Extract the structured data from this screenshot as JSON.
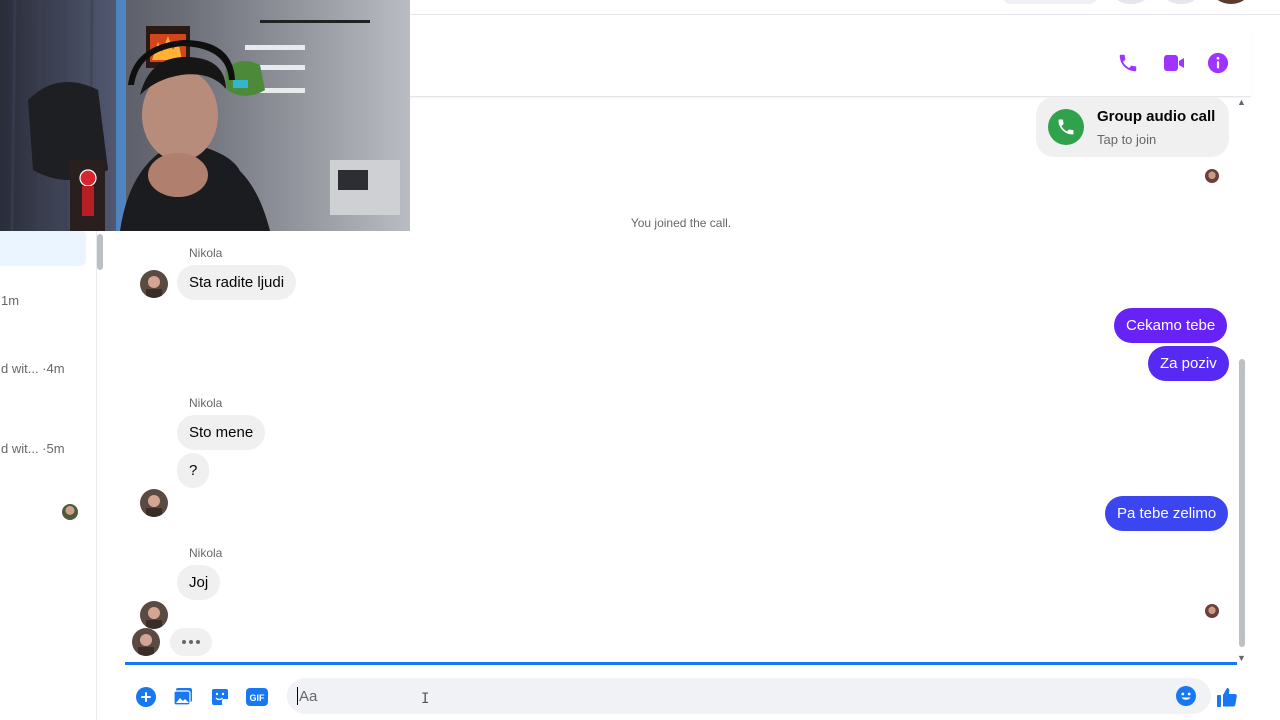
{
  "colors": {
    "accent_purple": "#a033ff",
    "bubble_violet": "#6723f5",
    "bubble_indigo": "#4630f4",
    "bubble_blue": "#3b46f1",
    "call_green": "#31a24c",
    "link_blue": "#1877f2"
  },
  "header": {
    "icons": [
      "phone-icon",
      "video-camera-icon",
      "info-icon"
    ]
  },
  "sidebar": {
    "items": [
      {
        "meta": "1m"
      },
      {
        "meta": "d wit... ·4m"
      },
      {
        "meta": "d wit... ·5m"
      }
    ]
  },
  "call_card": {
    "title": "Group audio call",
    "subtitle": "Tap to join"
  },
  "system_message": "You joined the call.",
  "messages": [
    {
      "sender": "Nikola",
      "texts": [
        "Sta radite ljudi"
      ]
    },
    {
      "outgoing": [
        "Cekamo tebe",
        "Za poziv"
      ]
    },
    {
      "sender": "Nikola",
      "texts": [
        "Sto mene",
        "?"
      ]
    },
    {
      "outgoing": [
        "Pa tebe zelimo"
      ]
    },
    {
      "sender": "Nikola",
      "texts": [
        "Joj"
      ]
    }
  ],
  "composer": {
    "placeholder": "Aa",
    "icons": [
      "plus-circle-icon",
      "photo-icon",
      "sticker-icon",
      "gif-icon",
      "emoji-icon",
      "thumbs-up-icon"
    ],
    "gif_label": "GIF"
  }
}
